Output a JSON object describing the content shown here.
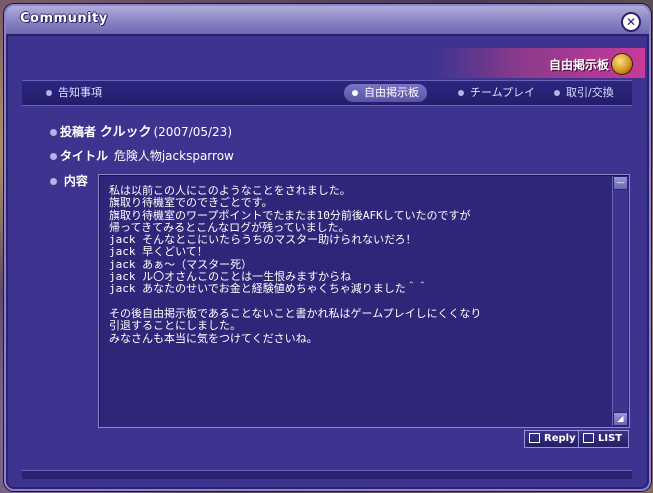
{
  "window": {
    "title": "Community"
  },
  "banner": {
    "label": "自由掲示板",
    "icon": "board-emblem-icon"
  },
  "tabs": [
    {
      "label": "告知事項",
      "active": false
    },
    {
      "label": "自由掲示板",
      "active": true
    },
    {
      "label": "チームプレイ",
      "active": false
    },
    {
      "label": "取引/交換",
      "active": false
    }
  ],
  "post": {
    "poster_label": "投稿者",
    "poster_name": "クルック",
    "date": "(2007/05/23)",
    "title_label": "タイトル",
    "title_value": "危険人物jacksparrow",
    "content_label": "内容",
    "content": "私は以前この人にこのようなことをされました。\n旗取り待機室でのできごとです。\n旗取り待機室のワープポイントでたまたま10分前後AFKしていたのですが\n帰ってきてみるとこんなログが残っていました。\njack そんなとこにいたらうちのマスター助けられないだろ！\njack 早くどいて！\njack あぁ～（マスター死）\njack ル〇オさんこのことは一生恨みますからね\njack あなたのせいでお金と経験値めちゃくちゃ減りました＾＾\n\nその後自由掲示板であることないこと書かれ私はゲームプレイしにくくなり\n引退することにしました。\nみなさんも本当に気をつけてくださいね。"
  },
  "buttons": {
    "reply": "Reply",
    "list": "LIST"
  },
  "colors": {
    "window_bg": "#3e3490",
    "accent": "#c83a9a",
    "text": "#ffffff"
  }
}
